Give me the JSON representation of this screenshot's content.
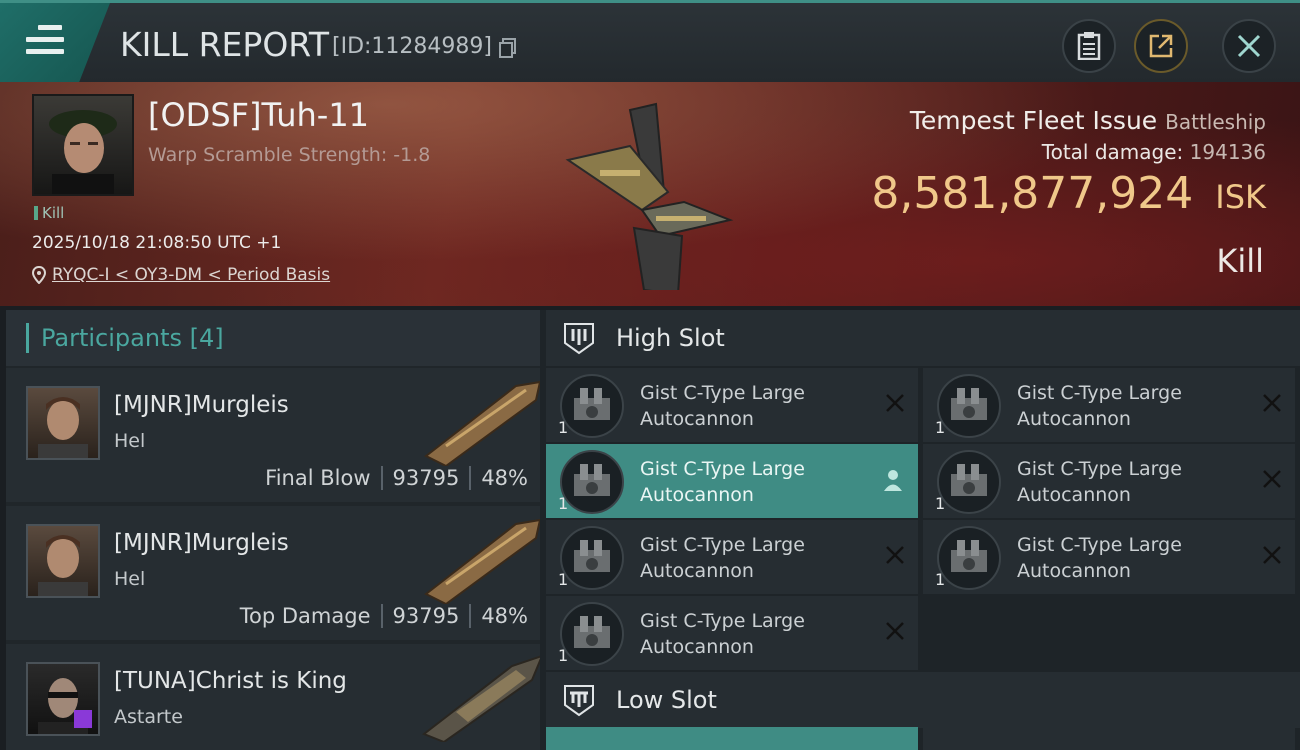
{
  "header": {
    "title": "KILL REPORT",
    "report_id": "[ID:11284989]",
    "icons": [
      "menu-icon",
      "copy-icon",
      "clipboard-icon",
      "share-icon",
      "close-icon"
    ]
  },
  "victim": {
    "name": "[ODSF]Tuh-11",
    "warp_scramble": "Warp Scramble Strength: -1.8",
    "tag": "Kill",
    "datetime": "2025/10/18 21:08:50 UTC +1",
    "location": "RYQC-I < OY3-DM < Period Basis",
    "ship": "Tempest Fleet Issue",
    "ship_class": "Battleship",
    "total_damage_label": "Total damage:",
    "total_damage": "194136",
    "isk_value": "8,581,877,924",
    "isk_unit": "ISK",
    "outcome": "Kill"
  },
  "participants": {
    "label": "Participants",
    "count": "[4]",
    "list": [
      {
        "name": "[MJNR]Murgleis",
        "ship": "Hel",
        "role": "Final Blow",
        "damage": "93795",
        "percent": "48%"
      },
      {
        "name": "[MJNR]Murgleis",
        "ship": "Hel",
        "role": "Top Damage",
        "damage": "93795",
        "percent": "48%"
      },
      {
        "name": "[TUNA]Christ is King",
        "ship": "Astarte",
        "role": "",
        "damage": "",
        "percent": ""
      }
    ]
  },
  "slots": {
    "high": {
      "label": "High Slot",
      "modules": [
        {
          "name": "Gist C-Type Large Autocannon",
          "qty": "1"
        },
        {
          "name": "Gist C-Type Large Autocannon",
          "qty": "1"
        },
        {
          "name": "Gist C-Type Large Autocannon",
          "qty": "1"
        },
        {
          "name": "Gist C-Type Large Autocannon",
          "qty": "1"
        },
        {
          "name": "Gist C-Type Large Autocannon",
          "qty": "1"
        },
        {
          "name": "Gist C-Type Large Autocannon",
          "qty": "1"
        },
        {
          "name": "Gist C-Type Large Autocannon",
          "qty": "1"
        }
      ]
    },
    "low": {
      "label": "Low Slot"
    }
  },
  "colors": {
    "accent": "#3f8c84",
    "isk": "#f0c88a",
    "banner": "#6b2a22"
  }
}
